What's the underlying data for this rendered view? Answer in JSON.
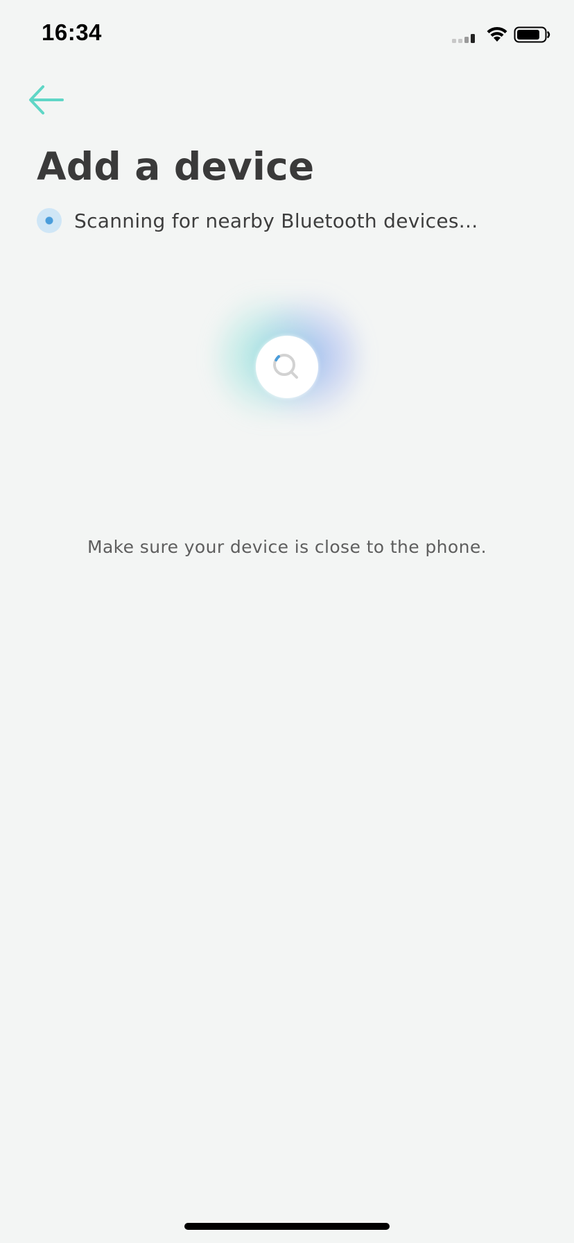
{
  "status_bar": {
    "time": "16:34",
    "icons": [
      "cellular-signal-icon",
      "wifi-icon",
      "battery-icon"
    ]
  },
  "header": {
    "back_icon": "arrow-left-icon",
    "title": "Add a device"
  },
  "scan_status": {
    "indicator_icon": "scanning-dot-icon",
    "text": "Scanning for nearby Bluetooth devices..."
  },
  "scanner": {
    "icon": "magnifier-icon"
  },
  "hint": {
    "text": "Make sure your device is close to the phone."
  },
  "colors": {
    "background": "#f3f5f4",
    "accent_teal": "#5fd6c6",
    "accent_blue": "#4a9ddb",
    "title_text": "#3a3a3a",
    "body_text": "#3e3e3e",
    "hint_text": "#5e5e5e"
  }
}
